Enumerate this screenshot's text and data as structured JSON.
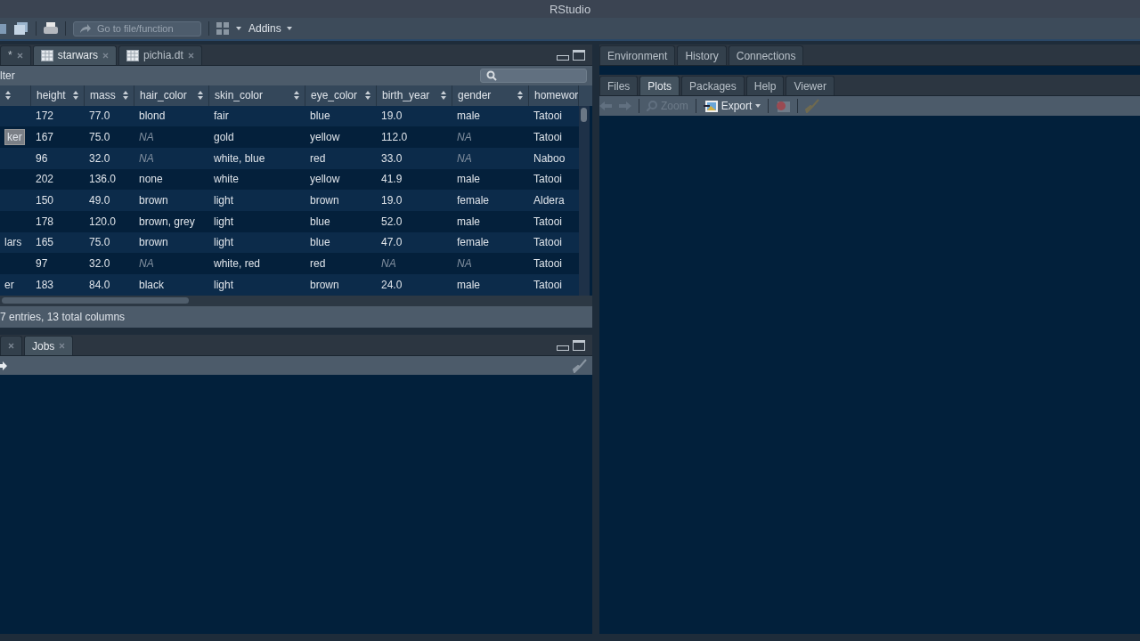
{
  "window": {
    "title": "RStudio"
  },
  "toolbar": {
    "goto_placeholder": "Go to file/function",
    "addins": "Addins"
  },
  "source_pane": {
    "tabs": [
      {
        "label": "*",
        "selected": false
      },
      {
        "label": "starwars",
        "selected": true
      },
      {
        "label": "pichia.dt",
        "selected": false
      }
    ],
    "filter_label": "lter",
    "columns": [
      "height",
      "mass",
      "hair_color",
      "skin_color",
      "eye_color",
      "birth_year",
      "gender",
      "homewor"
    ],
    "rows": [
      {
        "cells": [
          "172",
          "77.0",
          "blond",
          "fair",
          "blue",
          "19.0",
          "male",
          "Tatooi"
        ]
      },
      {
        "name": "ker",
        "name_selected": true,
        "cells": [
          "167",
          "75.0",
          {
            "text": "NA",
            "missing": true
          },
          "gold",
          "yellow",
          "112.0",
          {
            "text": "NA",
            "missing": true
          },
          "Tatooi"
        ]
      },
      {
        "cells": [
          "96",
          "32.0",
          {
            "text": "NA",
            "missing": true
          },
          "white, blue",
          "red",
          "33.0",
          {
            "text": "NA",
            "missing": true
          },
          "Naboo"
        ]
      },
      {
        "cells": [
          "202",
          "136.0",
          "none",
          "white",
          "yellow",
          "41.9",
          "male",
          "Tatooi"
        ]
      },
      {
        "cells": [
          "150",
          "49.0",
          "brown",
          "light",
          "brown",
          "19.0",
          "female",
          "Aldera"
        ]
      },
      {
        "cells": [
          "178",
          "120.0",
          "brown, grey",
          "light",
          "blue",
          "52.0",
          "male",
          "Tatooi"
        ]
      },
      {
        "name": "lars",
        "name_selected": false,
        "cells": [
          "165",
          "75.0",
          "brown",
          "light",
          "blue",
          "47.0",
          "female",
          "Tatooi"
        ]
      },
      {
        "cells": [
          "97",
          "32.0",
          {
            "text": "NA",
            "missing": true
          },
          "white, red",
          "red",
          {
            "text": "NA",
            "missing": true
          },
          {
            "text": "NA",
            "missing": true
          },
          "Tatooi"
        ]
      },
      {
        "name": "er",
        "name_selected": false,
        "cells": [
          "183",
          "84.0",
          "black",
          "light",
          "brown",
          "24.0",
          "male",
          "Tatooi"
        ]
      }
    ],
    "status": "7 entries, 13 total columns"
  },
  "console_pane": {
    "tabs": [
      {
        "selected": false
      },
      {
        "label": "Jobs",
        "selected": true
      }
    ]
  },
  "env_pane": {
    "tabs": [
      {
        "label": "Environment",
        "selected": false
      },
      {
        "label": "History",
        "selected": false
      },
      {
        "label": "Connections",
        "selected": false
      }
    ]
  },
  "files_pane": {
    "tabs": [
      {
        "label": "Files",
        "selected": false
      },
      {
        "label": "Plots",
        "selected": true
      },
      {
        "label": "Packages",
        "selected": false
      },
      {
        "label": "Help",
        "selected": false
      },
      {
        "label": "Viewer",
        "selected": false
      }
    ],
    "zoom": "Zoom",
    "export": "Export"
  }
}
